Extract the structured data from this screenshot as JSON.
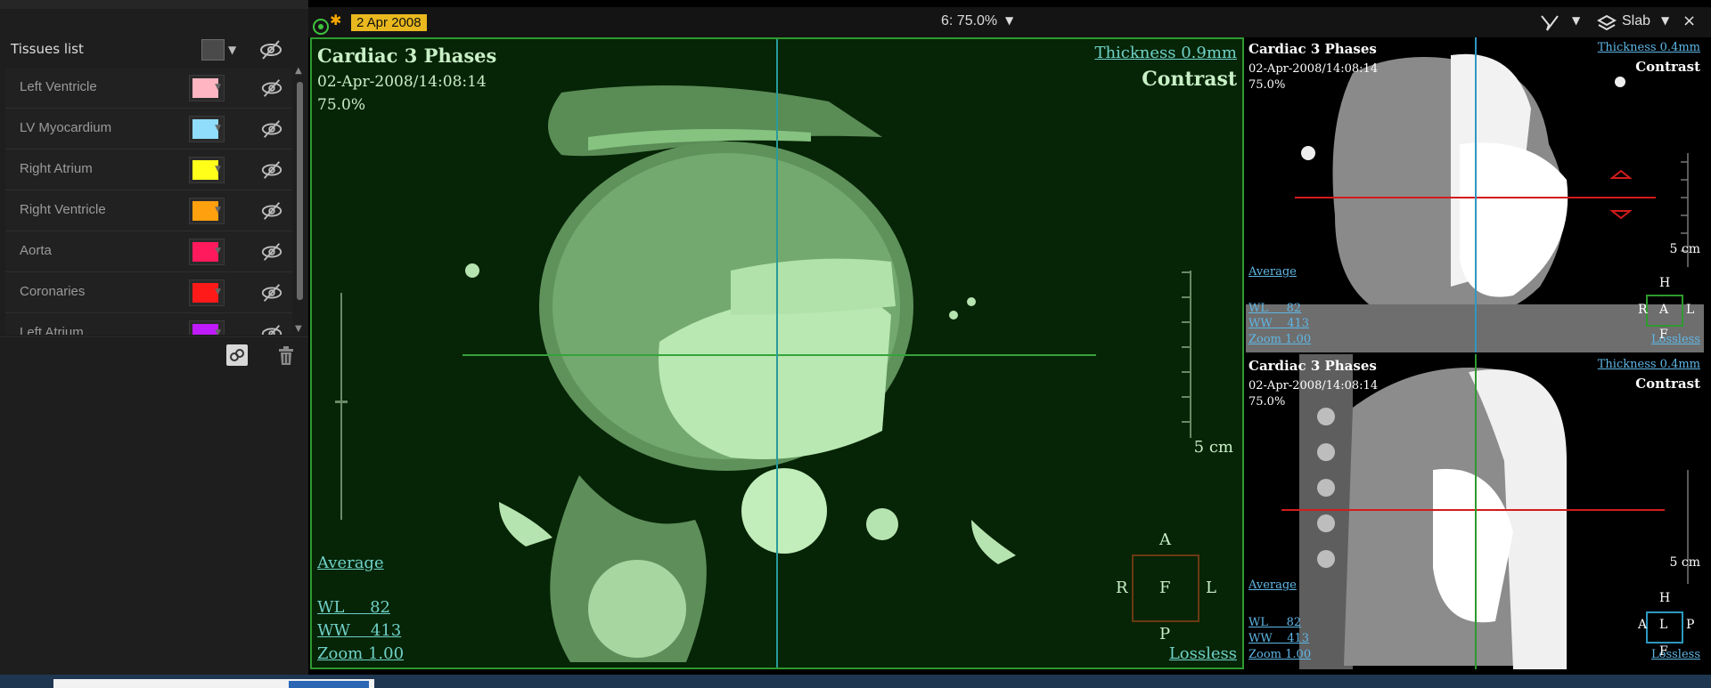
{
  "tissues": {
    "title": "Tissues list",
    "items": [
      {
        "label": "Left Ventricle",
        "color": "#ffb5c2"
      },
      {
        "label": "LV Myocardium",
        "color": "#8fdcfb"
      },
      {
        "label": "Right Atrium",
        "color": "#ffff1a"
      },
      {
        "label": "Right Ventricle",
        "color": "#ffa00f"
      },
      {
        "label": "Aorta",
        "color": "#ff1a5e"
      },
      {
        "label": "Coronaries",
        "color": "#ff1a1a"
      },
      {
        "label": "Left Atrium",
        "color": "#c01aff"
      }
    ]
  },
  "toolbar": {
    "date_badge": "2 Apr 2008",
    "zoom_readout": "6: 75.0%",
    "slab_label": "Slab",
    "close": "×"
  },
  "main_view": {
    "title": "Cardiac 3 Phases",
    "datetime": "02-Apr-2008/14:08:14",
    "zoom_pct": "75.0%",
    "thickness": "Thickness 0.9mm",
    "mode": "Contrast",
    "render": "Average",
    "wl": "WL     82",
    "ww": "WW    413",
    "zoom": "Zoom 1.00",
    "compression": "Lossless",
    "scale": "5 cm",
    "orient": {
      "top": "A",
      "left": "R",
      "center": "F",
      "right": "L",
      "bottom": "P"
    }
  },
  "side_views": [
    {
      "title": "Cardiac 3 Phases",
      "datetime": "02-Apr-2008/14:08:14",
      "zoom_pct": "75.0%",
      "thickness": "Thickness 0.4mm",
      "mode": "Contrast",
      "render": "Average",
      "wl": "WL     82",
      "ww": "WW    413",
      "zoom": "Zoom 1.00",
      "compression": "Lossless",
      "scale": "5 cm",
      "orient": {
        "top": "H",
        "left": "R",
        "center": "A",
        "right": "L",
        "bottom": "F"
      }
    },
    {
      "title": "Cardiac 3 Phases",
      "datetime": "02-Apr-2008/14:08:14",
      "zoom_pct": "75.0%",
      "thickness": "Thickness 0.4mm",
      "mode": "Contrast",
      "render": "Average",
      "wl": "WL     82",
      "ww": "WW    413",
      "zoom": "Zoom 1.00",
      "compression": "Lossless",
      "scale": "5 cm",
      "orient": {
        "top": "H",
        "left": "A",
        "center": "L",
        "right": "P",
        "bottom": "F"
      }
    }
  ]
}
